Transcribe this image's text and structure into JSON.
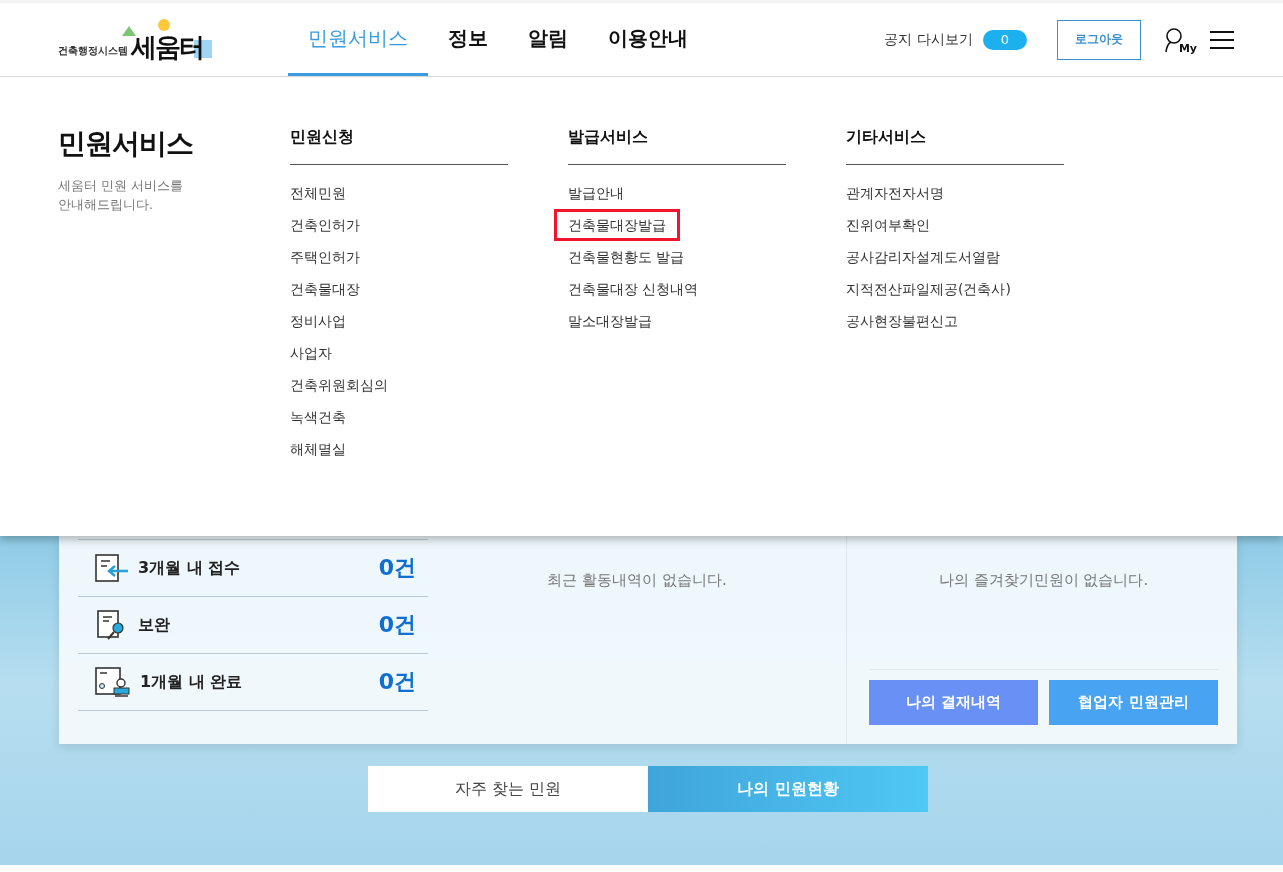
{
  "header": {
    "logo": {
      "name": "세움터",
      "subtitle": "건축행정시스템"
    },
    "nav": [
      {
        "label": "민원서비스",
        "selected": true
      },
      {
        "label": "정보",
        "selected": false
      },
      {
        "label": "알림",
        "selected": false
      },
      {
        "label": "이용안내",
        "selected": false
      }
    ],
    "notice_replay": {
      "label": "공지 다시보기",
      "count": "0"
    },
    "logout_button": "로그아웃",
    "my_label": "My"
  },
  "mega_menu": {
    "title": "민원서비스",
    "description": "세움터 민원 서비스를 안내해드립니다.",
    "columns": [
      {
        "heading": "민원신청",
        "items": [
          {
            "label": "전체민원",
            "highlighted": false
          },
          {
            "label": "건축인허가",
            "highlighted": false
          },
          {
            "label": "주택인허가",
            "highlighted": false
          },
          {
            "label": "건축물대장",
            "highlighted": false
          },
          {
            "label": "정비사업",
            "highlighted": false
          },
          {
            "label": "사업자",
            "highlighted": false
          },
          {
            "label": "건축위원회심의",
            "highlighted": false
          },
          {
            "label": "녹색건축",
            "highlighted": false
          },
          {
            "label": "해체멸실",
            "highlighted": false
          }
        ]
      },
      {
        "heading": "발급서비스",
        "items": [
          {
            "label": "발급안내",
            "highlighted": false
          },
          {
            "label": "건축물대장발급",
            "highlighted": true
          },
          {
            "label": "건축물현황도 발급",
            "highlighted": false
          },
          {
            "label": "건축물대장 신청내역",
            "highlighted": false
          },
          {
            "label": "말소대장발급",
            "highlighted": false
          }
        ]
      },
      {
        "heading": "기타서비스",
        "items": [
          {
            "label": "관계자전자서명",
            "highlighted": false
          },
          {
            "label": "진위여부확인",
            "highlighted": false
          },
          {
            "label": "공사감리자설계도서열람",
            "highlighted": false
          },
          {
            "label": "지적전산파일제공(건축사)",
            "highlighted": false
          },
          {
            "label": "공사현장불편신고",
            "highlighted": false
          }
        ]
      }
    ]
  },
  "dashboard": {
    "stats": [
      {
        "kind": "received",
        "label": "3개월 내 접수",
        "value": "0건"
      },
      {
        "kind": "supplement",
        "label": "보완",
        "value": "0건"
      },
      {
        "kind": "completed",
        "label": "1개월 내 완료",
        "value": "0건"
      }
    ],
    "recent_activity": "최근 활동내역이 없습니다.",
    "favorites": "나의 즐겨찾기민원이 없습니다.",
    "buttons": [
      "나의 결재내역",
      "협업자 민원관리"
    ]
  },
  "bottom_tabs": [
    {
      "label": "자주 찾는 민원",
      "selected": false
    },
    {
      "label": "나의 민원현황",
      "selected": true
    }
  ]
}
